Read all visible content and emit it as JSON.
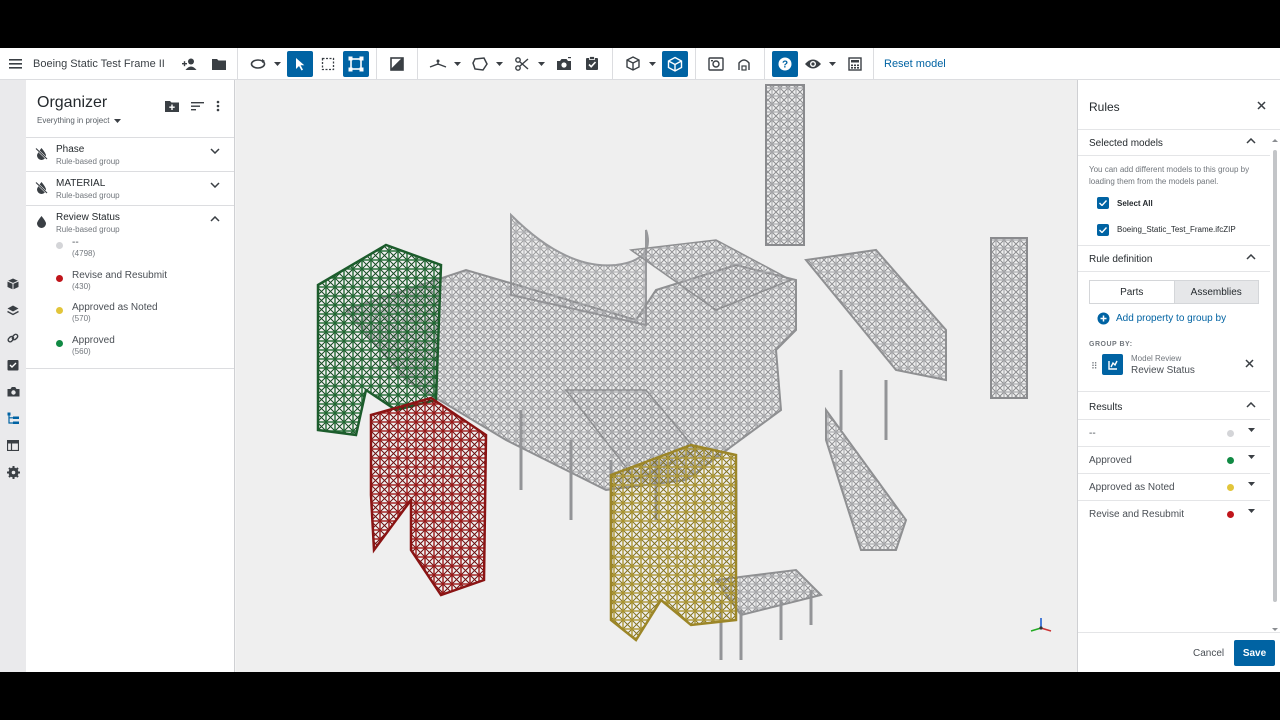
{
  "app": {
    "project_title": "Boeing Static Test Frame II",
    "reset_label": "Reset model"
  },
  "toolbar": {
    "icons": [
      "menu-icon",
      "add-user-icon",
      "folder-icon",
      "orbit-icon",
      "select-arrow-icon",
      "box-select-icon",
      "fit-view-icon",
      "section-icon",
      "measure-icon",
      "shape-icon",
      "cut-icon",
      "camera-icon",
      "task-icon",
      "cube-icon",
      "isometric-view-icon",
      "markup-icon",
      "tag-icon",
      "help-icon",
      "visibility-eye-icon",
      "calculator-icon"
    ]
  },
  "organizer": {
    "title": "Organizer",
    "scope": "Everything in project",
    "groups": [
      {
        "name": "Phase",
        "type": "Rule-based group"
      },
      {
        "name": "MATERIAL",
        "type": "Rule-based group"
      },
      {
        "name": "Review Status",
        "type": "Rule-based group",
        "items": [
          {
            "name": "--",
            "count": "(4798)",
            "color": "#d4d5d8"
          },
          {
            "name": "Revise and Resubmit",
            "count": "(430)",
            "color": "#c0151b"
          },
          {
            "name": "Approved as Noted",
            "count": "(570)",
            "color": "#e2c53a"
          },
          {
            "name": "Approved",
            "count": "(560)",
            "color": "#118a44"
          }
        ]
      }
    ]
  },
  "rules": {
    "title": "Rules",
    "selected_models": {
      "title": "Selected models",
      "help": "You can add different models to this group by loading them from the models panel.",
      "select_all": "Select All",
      "model_name": "Boeing_Static_Test_Frame.ifcZIP"
    },
    "rule_definition": {
      "title": "Rule definition",
      "tab_parts": "Parts",
      "tab_assemblies": "Assemblies",
      "add_property": "Add property to group by",
      "group_by_label": "GROUP BY:",
      "group_source": "Model Review",
      "group_name": "Review Status"
    },
    "results": {
      "title": "Results",
      "rows": [
        {
          "name": "--",
          "color": "#d4d5d8"
        },
        {
          "name": "Approved",
          "color": "#118a44"
        },
        {
          "name": "Approved as Noted",
          "color": "#e2c53a"
        },
        {
          "name": "Revise and Resubmit",
          "color": "#c0151b"
        }
      ]
    },
    "cancel_label": "Cancel",
    "save_label": "Save"
  },
  "colors": {
    "accent": "#0063a3",
    "structure_gray": "#9a9b9e",
    "approved": "#1f5f2e",
    "revise": "#8f1414",
    "approved_as_noted": "#a8922c"
  }
}
